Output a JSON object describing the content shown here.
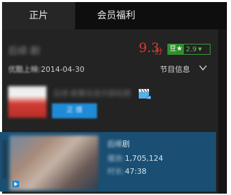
{
  "tabs": [
    {
      "label": "正片",
      "active": true
    },
    {
      "label": "会员福利",
      "active": false
    }
  ],
  "header": {
    "title_blurred": "后续·剧",
    "score": "9.3",
    "score_unit": "分",
    "douban": {
      "label": "豆★",
      "value": "2.9",
      "icon": "chevron-down-icon"
    },
    "online_prefix": "优酷上映:",
    "online_date": "2014-04-30",
    "program_info_label": "节目信息"
  },
  "episodes": [
    {
      "title_blurred": "后续·剧集信息内容标题",
      "button_label": "正 播",
      "icon": "clapperboard-icon"
    },
    {
      "title_blurred": "后续",
      "title_suffix": "剧",
      "stat1_prefix_blurred": "播放:",
      "stat1_value": "1,705,124",
      "stat2_prefix_blurred": "时长:",
      "stat2_value": "47:38"
    }
  ],
  "colors": {
    "score_red": "#e23a2e",
    "douban_green": "#2e8f2a",
    "active_row_blue": "#1a4f73",
    "button_blue": "#1f8ad6"
  }
}
